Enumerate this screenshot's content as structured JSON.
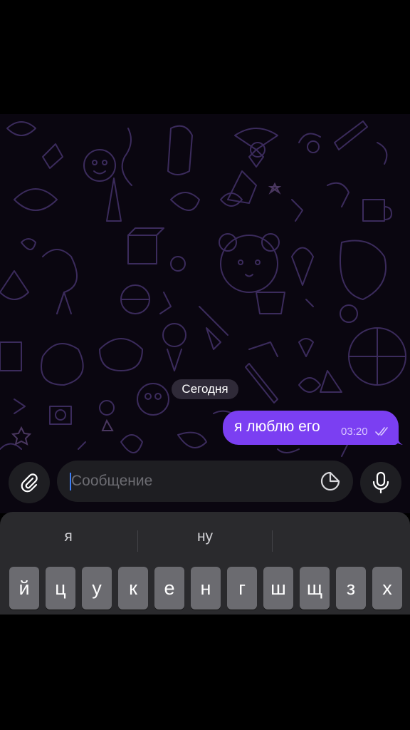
{
  "chat": {
    "date_label": "Сегодня",
    "messages": [
      {
        "text": "я люблю его",
        "time": "03:20",
        "status": "read",
        "outgoing": true
      }
    ]
  },
  "composer": {
    "placeholder": "Сообщение",
    "attach_icon": "paperclip-icon",
    "sticker_icon": "sticker-icon",
    "mic_icon": "microphone-icon"
  },
  "keyboard": {
    "suggestions": [
      "я",
      "ну",
      ""
    ],
    "row1": [
      "й",
      "ц",
      "у",
      "к",
      "е",
      "н",
      "г",
      "ш",
      "щ",
      "з",
      "х"
    ]
  },
  "colors": {
    "accent": "#7b3ff2",
    "background": "#000000",
    "input_bg": "#1e1e22",
    "keyboard_bg": "#2a2a2d",
    "key_bg": "#6b6b70",
    "caret": "#3d7ef5"
  }
}
